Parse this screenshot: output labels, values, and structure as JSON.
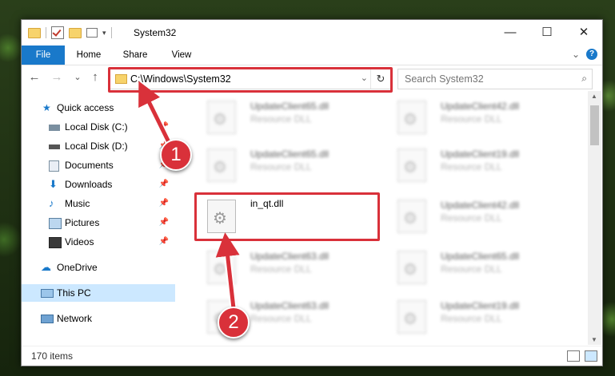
{
  "window": {
    "title": "System32"
  },
  "controls": {
    "minimize": "—",
    "maximize": "☐",
    "close": "✕"
  },
  "ribbon": {
    "tabs": [
      "File",
      "Home",
      "Share",
      "View"
    ],
    "collapse": "⌄",
    "help": "?"
  },
  "nav": {
    "back": "←",
    "forward": "→",
    "recent": "⌄",
    "up": "↑"
  },
  "address": {
    "path": "C:\\Windows\\System32",
    "dropdown": "⌄",
    "refresh": "↻"
  },
  "search": {
    "placeholder": "Search System32",
    "icon": "⌕"
  },
  "sidebar": {
    "items": [
      {
        "label": "Quick access",
        "icon": "star-icon",
        "pinned": false
      },
      {
        "label": "Local Disk (C:)",
        "icon": "drive-icon",
        "pinned": true
      },
      {
        "label": "Local Disk (D:)",
        "icon": "drive-icon",
        "pinned": true
      },
      {
        "label": "Documents",
        "icon": "documents-icon",
        "pinned": true
      },
      {
        "label": "Downloads",
        "icon": "downloads-icon",
        "pinned": true
      },
      {
        "label": "Music",
        "icon": "music-icon",
        "pinned": true
      },
      {
        "label": "Pictures",
        "icon": "pictures-icon",
        "pinned": true
      },
      {
        "label": "Videos",
        "icon": "videos-icon",
        "pinned": true
      },
      {
        "label": "OneDrive",
        "icon": "onedrive-icon",
        "pinned": false
      },
      {
        "label": "This PC",
        "icon": "this-pc-icon",
        "pinned": false,
        "selected": true
      },
      {
        "label": "Network",
        "icon": "network-icon",
        "pinned": false
      }
    ],
    "pin_glyph": "📌"
  },
  "files": [
    {
      "name": "UpdateClient65.dll",
      "desc": "Resource DLL"
    },
    {
      "name": "UpdateClient42.dll",
      "desc": "Resource DLL"
    },
    {
      "name": "UpdateClient65.dll",
      "desc": "Resource DLL"
    },
    {
      "name": "UpdateClient19.dll",
      "desc": "Resource DLL"
    },
    {
      "name": "in_qt.dll",
      "desc": ""
    },
    {
      "name": "UpdateClient42.dll",
      "desc": "Resource DLL"
    },
    {
      "name": "UpdateClient63.dll",
      "desc": "Resource DLL"
    },
    {
      "name": "UpdateClient65.dll",
      "desc": "Resource DLL"
    },
    {
      "name": "UpdateClient63.dll",
      "desc": "Resource DLL"
    },
    {
      "name": "UpdateClient19.dll",
      "desc": "Resource DLL"
    }
  ],
  "status": {
    "count": "170 items"
  },
  "callouts": [
    "1",
    "2"
  ],
  "colors": {
    "accent": "#1979ca",
    "highlight": "#d9313a",
    "selection": "#cce8ff"
  }
}
